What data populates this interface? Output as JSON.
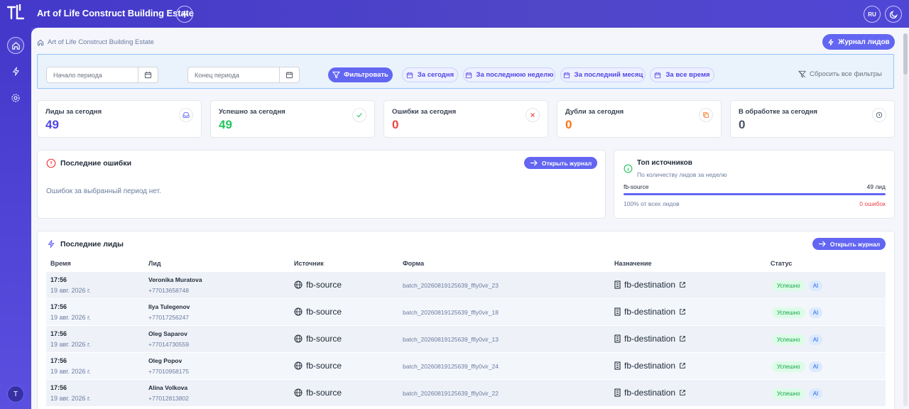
{
  "app": {
    "title": "Art of Life Construct Building Estate",
    "lang": "RU",
    "user_initial": "T"
  },
  "breadcrumb": "Art of Life Construct Building Estate",
  "journal_button": "Журнал лидов",
  "filters": {
    "start_placeholder": "Начало периода",
    "end_placeholder": "Конец периода",
    "filter_button": "Фильтровать",
    "chips": [
      "За сегодня",
      "За последнюю неделю",
      "За последний месяц",
      "За все время"
    ],
    "reset": "Сбросить все фильтры"
  },
  "stats": [
    {
      "label": "Лиды за сегодня",
      "value": "49",
      "color": "#4f46e5",
      "icon": "inbox-icon"
    },
    {
      "label": "Успешно за сегодня",
      "value": "49",
      "color": "#22c55e",
      "icon": "check-icon"
    },
    {
      "label": "Ошибки за сегодня",
      "value": "0",
      "color": "#ef4444",
      "icon": "x-icon"
    },
    {
      "label": "Дубли за сегодня",
      "value": "0",
      "color": "#f97316",
      "icon": "copy-icon"
    },
    {
      "label": "В обработке за сегодня",
      "value": "0",
      "color": "#4b5563",
      "icon": "clock-icon"
    }
  ],
  "errors_panel": {
    "title": "Последние ошибки",
    "button": "Открыть журнал",
    "empty": "Ошибок за выбранный период нет."
  },
  "sources_panel": {
    "title": "Топ источников",
    "subtitle": "По количеству лидов за неделю",
    "source_name": "fb-source",
    "source_count": "49 лид",
    "share": 1.0,
    "share_text": "100% от всех лидов",
    "errors_text": "0 ошибок"
  },
  "leads_panel": {
    "title": "Последние лиды",
    "button": "Открыть журнал",
    "columns": [
      "Время",
      "Лид",
      "Источник",
      "Форма",
      "Назначение",
      "Статус"
    ],
    "rows": [
      {
        "time": "17:56",
        "date": "19 авг. 2026 г.",
        "name": "Veronika Muratova",
        "phone": "+77013658748",
        "source": "fb-source",
        "form": "batch_20260819125639_ffly0vir_23",
        "dest": "fb-destination",
        "status": "Успешно",
        "tag": "AI"
      },
      {
        "time": "17:56",
        "date": "19 авг. 2026 г.",
        "name": "Ilya Tulegenov",
        "phone": "+77017256247",
        "source": "fb-source",
        "form": "batch_20260819125639_ffly0vir_18",
        "dest": "fb-destination",
        "status": "Успешно",
        "tag": "AI"
      },
      {
        "time": "17:56",
        "date": "19 авг. 2026 г.",
        "name": "Oleg Saparov",
        "phone": "+77014730559",
        "source": "fb-source",
        "form": "batch_20260819125639_ffly0vir_13",
        "dest": "fb-destination",
        "status": "Успешно",
        "tag": "AI"
      },
      {
        "time": "17:56",
        "date": "19 авг. 2026 г.",
        "name": "Oleg Popov",
        "phone": "+77010958175",
        "source": "fb-source",
        "form": "batch_20260819125639_ffly0vir_24",
        "dest": "fb-destination",
        "status": "Успешно",
        "tag": "AI"
      },
      {
        "time": "17:56",
        "date": "19 авг. 2026 г.",
        "name": "Alina Volkova",
        "phone": "+77012813802",
        "source": "fb-source",
        "form": "batch_20260819125639_ffly0vir_22",
        "dest": "fb-destination",
        "status": "Успешно",
        "tag": "AI"
      }
    ]
  }
}
